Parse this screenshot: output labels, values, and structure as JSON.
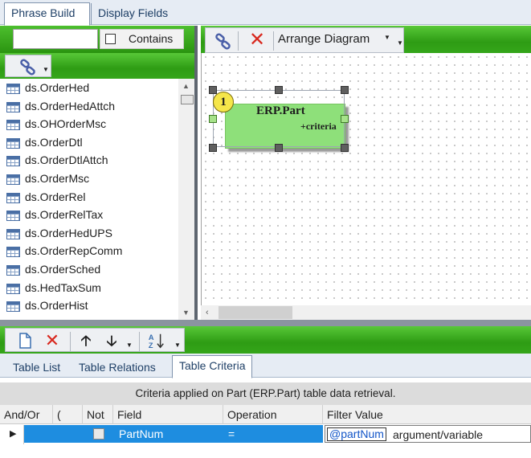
{
  "top_tabs": {
    "phrase_build": "Phrase Build",
    "display_fields": "Display Fields"
  },
  "search": {
    "value": "",
    "contains_label": "Contains",
    "contains_checked": false
  },
  "tree": {
    "items": [
      "ds.OrderHed",
      "ds.OrderHedAttch",
      "ds.OHOrderMsc",
      "ds.OrderDtl",
      "ds.OrderDtlAttch",
      "ds.OrderMsc",
      "ds.OrderRel",
      "ds.OrderRelTax",
      "ds.OrderHedUPS",
      "ds.OrderRepComm",
      "ds.OrderSched",
      "ds.HedTaxSum",
      "ds.OrderHist"
    ]
  },
  "diagram_toolbar": {
    "arrange_label": "Arrange Diagram"
  },
  "node": {
    "badge": "1",
    "title": "ERP.Part",
    "subtitle": "+criteria"
  },
  "bottom_tabs": {
    "list": "Table List",
    "relations": "Table Relations",
    "criteria": "Table Criteria"
  },
  "criteria": {
    "caption": "Criteria applied on Part (ERP.Part)  table data retrieval.",
    "headers": {
      "and_or": "And/Or",
      "paren": "(",
      "not": "Not",
      "field": "Field",
      "operation": "Operation",
      "filter_value": "Filter Value"
    },
    "row": {
      "field": "PartNum",
      "operation": "=",
      "filter_token": "@partNum",
      "filter_text": "argument/variable",
      "not_checked": false
    }
  },
  "colors": {
    "accent_green": "#2e9c14",
    "node_fill": "#8ee07a",
    "row_selected": "#1e8de0",
    "delete_red": "#d8281e"
  },
  "icons": [
    "link-icon",
    "delete-icon",
    "new-document-icon",
    "move-up-icon",
    "move-down-icon",
    "sort-az-icon",
    "table-icon"
  ]
}
